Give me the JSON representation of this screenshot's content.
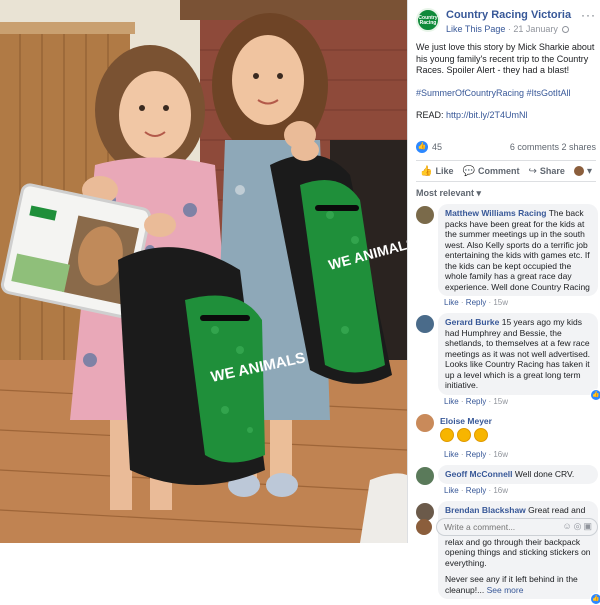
{
  "post": {
    "page_name": "Country Racing Victoria",
    "page_logo_text": "Country Racing",
    "like_page": "Like This Page",
    "date": "21 January",
    "text_1": "We just love this story by Mick Sharkie about his young family's recent trip to the Country Races. Spoiler Alert - they had a blast!",
    "hashtags": "#SummerOfCountryRacing #ItsGotItAll",
    "read_label": "READ:",
    "read_link": "http://bit.ly/2T4UmNl",
    "reaction_count": "45",
    "comments_count": "6 comments",
    "shares_count": "2 shares"
  },
  "actions": {
    "like": "Like",
    "comment": "Comment",
    "share": "Share"
  },
  "sort_label": "Most relevant",
  "comments": [
    {
      "name": "Matthew Williams Racing",
      "text": "The back packs have been great for the kids at the summer meetings up in the south west. Also Kelly sports do a terrific job entertaining the kids with games etc. If the kids can be kept occupied the whole family has a great race day experience. Well done Country Racing",
      "like": "Like",
      "reply": "Reply",
      "time": "15w",
      "avatar_color": "#7a6a4a"
    },
    {
      "name": "Gerard Burke",
      "text": "15 years ago my kids had Humphrey and Bessie, the shetlands, to themselves at a few race meetings as it was not well advertised. Looks like Country Racing has taken it up a level which is a great long term initiative.",
      "like": "Like",
      "reply": "Reply",
      "time": "15w",
      "avatar_color": "#4a6b8a"
    },
    {
      "name": "Eloise Meyer",
      "text": "",
      "like": "Like",
      "reply": "Reply",
      "time": "16w",
      "avatar_color": "#c98a5a"
    },
    {
      "name": "Geoff McConnell",
      "text": "Well done CRV.",
      "like": "Like",
      "reply": "Reply",
      "time": "16w",
      "avatar_color": "#5a7a5a"
    },
    {
      "name": "Brendan Blackshaw",
      "text": "Great read and yes it's amazing how many times we see kids come in and sit down and just relax and go through their backpack opening things and sticking stickers on everything.",
      "text_2": "Never see any if it left behind in the cleanup!...",
      "see_more": "See more",
      "avatar_color": "#6b5a4a"
    }
  ],
  "write_comment_placeholder": "Write a comment...",
  "photo": {
    "backpack_text": "WE ANIMALS",
    "accent_green": "#1f8f3a"
  }
}
